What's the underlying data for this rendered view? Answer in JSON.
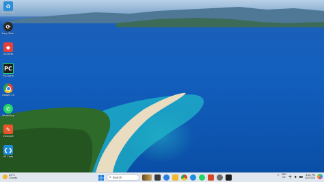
{
  "desktop": {
    "icons": [
      {
        "label": "Recycle Bin",
        "icon": "recycle-bin-icon",
        "color": "#2c8fd6"
      },
      {
        "label": "Easy Disk Recovery",
        "icon": "disk-recovery-icon",
        "color": "#2b2b2b"
      },
      {
        "label": "Anydesk",
        "icon": "anydesk-icon",
        "color": "#e5403a"
      },
      {
        "label": "PyCharm",
        "icon": "pycharm-icon",
        "color": "#1e1e1e"
      },
      {
        "label": "Google Chrome",
        "icon": "chrome-icon",
        "color": "#e4432f"
      },
      {
        "label": "WhatsApp",
        "icon": "whatsapp-icon",
        "color": "#25d366"
      },
      {
        "label": "Inkscape",
        "icon": "inkscape-icon",
        "color": "#e8552d"
      },
      {
        "label": "VS Code",
        "icon": "vscode-icon",
        "color": "#1e8ad6"
      }
    ]
  },
  "taskbar": {
    "weather": {
      "temp": "22°C",
      "condition": "Cloudy"
    },
    "search_placeholder": "Search",
    "apps": [
      {
        "name": "widget-app",
        "color": "#7a5a2a"
      },
      {
        "name": "task-view",
        "color": "#444444"
      },
      {
        "name": "copilot-app",
        "color": "#2d7de0"
      },
      {
        "name": "file-explorer",
        "color": "#f2b632"
      },
      {
        "name": "chrome",
        "color": "#e4432f"
      },
      {
        "name": "edge",
        "color": "#1d8fe0"
      },
      {
        "name": "whatsapp",
        "color": "#25d366"
      },
      {
        "name": "powerpoint",
        "color": "#d24726"
      },
      {
        "name": "settings",
        "color": "#6a6a6a"
      },
      {
        "name": "pycharm",
        "color": "#1e1e1e"
      },
      {
        "name": "notes",
        "color": "#2aa89a"
      }
    ],
    "tray": {
      "lang_line1": "ENG",
      "lang_line2": "US",
      "time": "8:01 PM",
      "date": "2/3/2024"
    }
  }
}
